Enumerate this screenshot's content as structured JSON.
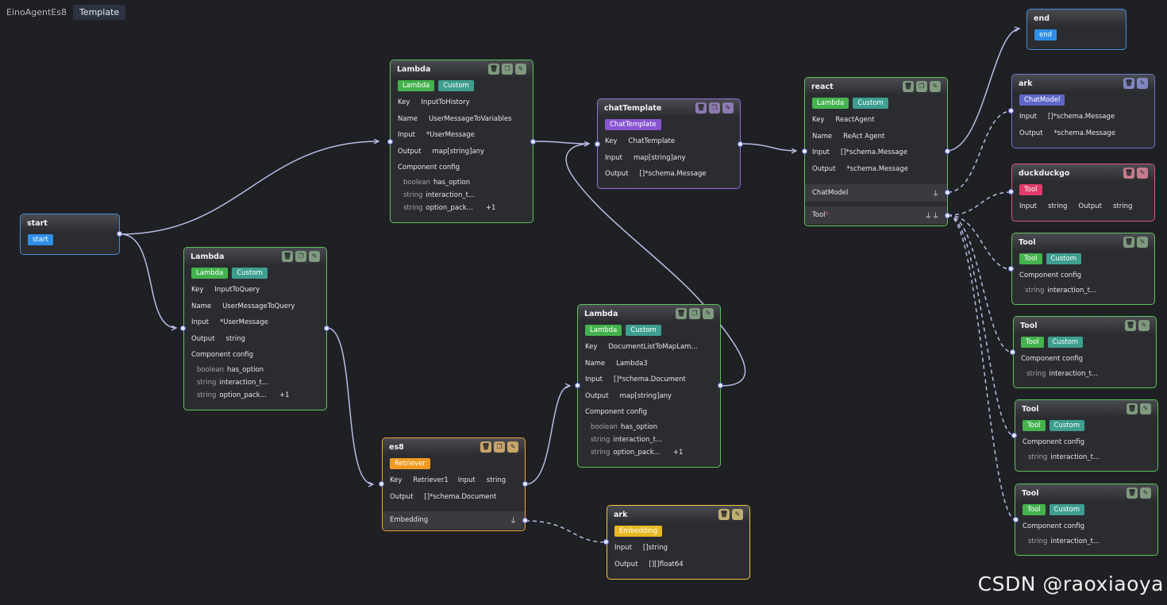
{
  "header": {
    "app_name": "EinoAgentEs8",
    "template_label": "Template"
  },
  "colors": {
    "edge": "#b7bce6",
    "port_border": "#6470e6"
  },
  "nodes": {
    "start": {
      "title": "start",
      "tag": "start"
    },
    "end": {
      "title": "end",
      "tag": "end"
    },
    "lambda_history": {
      "title": "Lambda",
      "tags": [
        "Lambda",
        "Custom"
      ],
      "key_label": "Key",
      "key": "InputToHistory",
      "name_label": "Name",
      "name": "UserMessageToVariables",
      "input_label": "Input",
      "input": "*UserMessage",
      "output_label": "Output",
      "output": "map[string]any",
      "config_label": "Component config",
      "config": [
        {
          "type": "boolean",
          "name": "has_option"
        },
        {
          "type": "string",
          "name": "interaction_t..."
        },
        {
          "type": "string",
          "name": "option_pack...",
          "more": "+1"
        }
      ]
    },
    "lambda_query": {
      "title": "Lambda",
      "tags": [
        "Lambda",
        "Custom"
      ],
      "key_label": "Key",
      "key": "InputToQuery",
      "name_label": "Name",
      "name": "UserMessageToQuery",
      "input_label": "Input",
      "input": "*UserMessage",
      "output_label": "Output",
      "output": "string",
      "config_label": "Component config",
      "config": [
        {
          "type": "boolean",
          "name": "has_option"
        },
        {
          "type": "string",
          "name": "interaction_t..."
        },
        {
          "type": "string",
          "name": "option_pack...",
          "more": "+1"
        }
      ]
    },
    "chat_template": {
      "title": "chatTemplate",
      "tag": "ChatTemplate",
      "key_label": "Key",
      "key": "ChatTemplate",
      "input_label": "Input",
      "input": "map[string]any",
      "output_label": "Output",
      "output": "[]*schema.Message"
    },
    "react": {
      "title": "react",
      "tags": [
        "Lambda",
        "Custom"
      ],
      "key_label": "Key",
      "key": "ReactAgent",
      "name_label": "Name",
      "name": "ReAct Agent",
      "input_label": "Input",
      "input": "[]*schema.Message",
      "output_label": "Output",
      "output": "*schema.Message",
      "chatmodel_label": "ChatModel",
      "tool_label": "Tool",
      "tool_required": "*"
    },
    "lambda_doc": {
      "title": "Lambda",
      "tags": [
        "Lambda",
        "Custom"
      ],
      "key_label": "Key",
      "key": "DocumentListToMapLam...",
      "name_label": "Name",
      "name": "Lambda3",
      "input_label": "Input",
      "input": "[]*schema.Document",
      "output_label": "Output",
      "output": "map[string]any",
      "config_label": "Component config",
      "config": [
        {
          "type": "boolean",
          "name": "has_option"
        },
        {
          "type": "string",
          "name": "interaction_t..."
        },
        {
          "type": "string",
          "name": "option_pack...",
          "more": "+1"
        }
      ]
    },
    "es8": {
      "title": "es8",
      "tag": "Retriever",
      "key_label": "Key",
      "key": "Retriever1",
      "input_label": "Input",
      "input": "string",
      "output_label": "Output",
      "output": "[]*schema.Document",
      "embedding_label": "Embedding"
    },
    "ark_embed": {
      "title": "ark",
      "tag": "Embedding",
      "input_label": "Input",
      "input": "[]string",
      "output_label": "Output",
      "output": "[][]float64"
    },
    "ark_chat": {
      "title": "ark",
      "tag": "ChatModel",
      "input_label": "Input",
      "input": "[]*schema.Message",
      "output_label": "Output",
      "output": "*schema.Message"
    },
    "duckduckgo": {
      "title": "duckduckgo",
      "tag": "Tool",
      "input_label": "Input",
      "input": "string",
      "output_label": "Output",
      "output": "string"
    },
    "tools": [
      {
        "title": "Tool",
        "tags": [
          "Tool",
          "Custom"
        ],
        "config_label": "Component config",
        "config_type": "string",
        "config_name": "interaction_t..."
      },
      {
        "title": "Tool",
        "tags": [
          "Tool",
          "Custom"
        ],
        "config_label": "Component config",
        "config_type": "string",
        "config_name": "interaction_t..."
      },
      {
        "title": "Tool",
        "tags": [
          "Tool",
          "Custom"
        ],
        "config_label": "Component config",
        "config_type": "string",
        "config_name": "interaction_t..."
      },
      {
        "title": "Tool",
        "tags": [
          "Tool",
          "Custom"
        ],
        "config_label": "Component config",
        "config_type": "string",
        "config_name": "interaction_t..."
      }
    ]
  },
  "watermark": "CSDN @raoxiaoya"
}
